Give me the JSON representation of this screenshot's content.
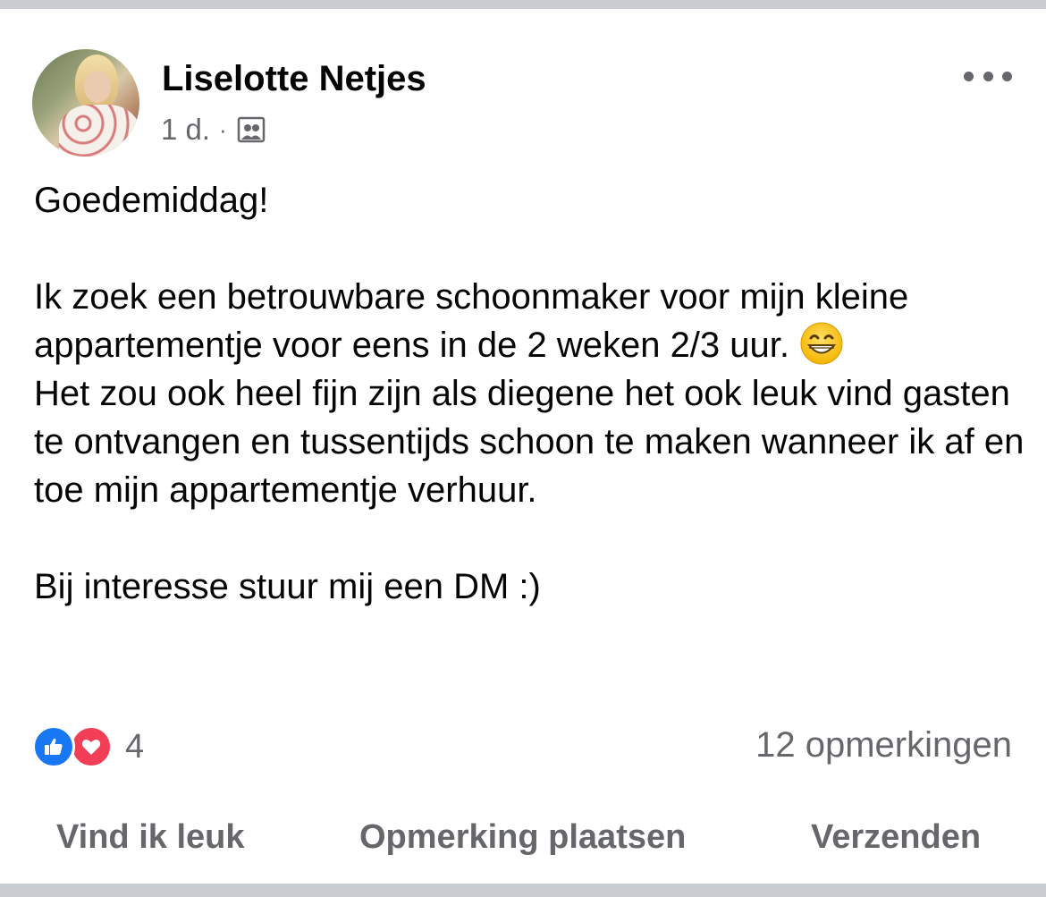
{
  "post": {
    "author": "Liselotte Netjes",
    "timestamp": "1 d.",
    "separator": "·",
    "audience_icon": "group-icon",
    "more_icon": "more-icon",
    "paragraphs": [
      "Goedemiddag!",
      "Ik zoek een betrouwbare schoonmaker voor mijn kleine appartementje voor eens in de 2 weken 2/3 uur.",
      "Het zou ook heel fijn zijn als diegene het ook leuk vind gasten te ontvangen en tussentijds schoon te maken wanneer ik af en toe mijn appartementje verhuur.",
      "Bij interesse stuur mij een DM :)"
    ],
    "emoji": "grinning-face-with-smiling-eyes"
  },
  "reactions": {
    "icons": [
      "like-icon",
      "love-icon"
    ],
    "count": "4",
    "comments": "12 opmerkingen"
  },
  "actions": {
    "like": "Vind ik leuk",
    "comment": "Opmerking plaatsen",
    "share": "Verzenden"
  },
  "colors": {
    "like_blue": "#1877f2",
    "love_red": "#f33e58",
    "secondary_text": "#65676b",
    "primary_text": "#050505",
    "separator_bg": "#c9ccd1"
  }
}
